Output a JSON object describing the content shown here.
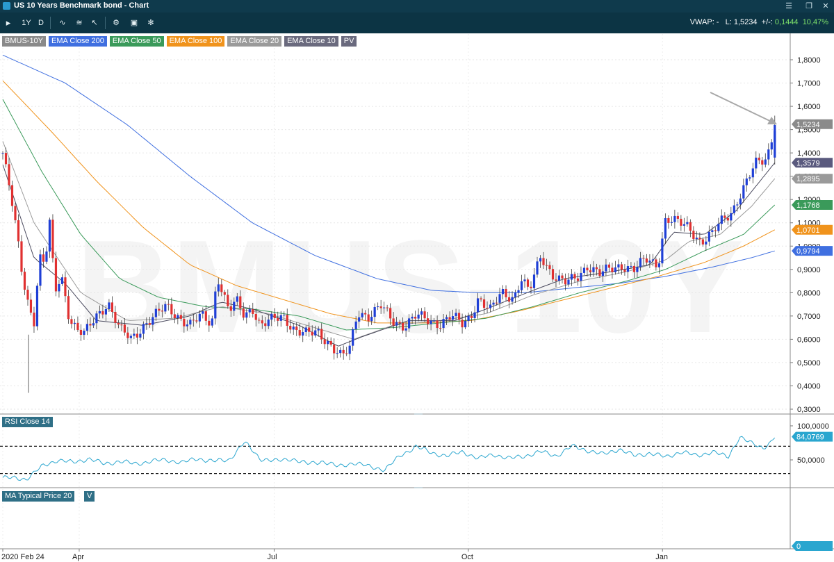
{
  "window": {
    "title": "US 10 Years Benchmark bond - Chart"
  },
  "toolbar": {
    "period": "1Y",
    "interval": "D",
    "vwap_label": "VWAP: -",
    "last_label": "L: 1,5234",
    "change_label": "+/-:",
    "change_value": "0,1444",
    "change_pct": "10,47%"
  },
  "legend": [
    {
      "label": "BMUS-10Y",
      "color": "#8a8a8a"
    },
    {
      "label": "EMA Close 200",
      "color": "#3f6fe0"
    },
    {
      "label": "EMA Close 50",
      "color": "#3a9a5a"
    },
    {
      "label": "EMA Close 100",
      "color": "#f0931c"
    },
    {
      "label": "EMA Close 20",
      "color": "#9a9a9a"
    },
    {
      "label": "EMA Close 10",
      "color": "#6a6a7e"
    },
    {
      "label": "PV",
      "color": "#6a6a7e"
    }
  ],
  "watermark": "BMUS-10Y",
  "rsi_label": "RSI Close 14",
  "ma_label": "MA Typical Price 20",
  "ma_flag": "V",
  "chart_data": {
    "type": "candlestick",
    "price_axis": {
      "min": 0.25,
      "max": 1.9,
      "ticks": [
        "1,8000",
        "1,7000",
        "1,6000",
        "1,5000",
        "1,4000",
        "1,3000",
        "1,2000",
        "1,1000",
        "1,0000",
        "0,9000",
        "0,8000",
        "0,7000",
        "0,6000",
        "0,5000",
        "0,4000",
        "0,3000"
      ]
    },
    "x_axis": {
      "labels": [
        {
          "label": "2020 Feb 24",
          "t": 0
        },
        {
          "label": "Apr",
          "t": 0.098
        },
        {
          "label": "Jul",
          "t": 0.348
        },
        {
          "label": "Oct",
          "t": 0.597
        },
        {
          "label": "Jan",
          "t": 0.846
        }
      ]
    },
    "price_keypoints": [
      [
        0.0,
        1.4
      ],
      [
        0.01,
        1.22
      ],
      [
        0.018,
        1.05
      ],
      [
        0.025,
        0.88
      ],
      [
        0.033,
        0.75
      ],
      [
        0.04,
        0.68
      ],
      [
        0.047,
        0.95
      ],
      [
        0.054,
        0.92
      ],
      [
        0.06,
        1.1
      ],
      [
        0.067,
        0.8
      ],
      [
        0.075,
        0.88
      ],
      [
        0.085,
        0.7
      ],
      [
        0.095,
        0.64
      ],
      [
        0.105,
        0.62
      ],
      [
        0.12,
        0.7
      ],
      [
        0.135,
        0.76
      ],
      [
        0.15,
        0.64
      ],
      [
        0.165,
        0.6
      ],
      [
        0.18,
        0.66
      ],
      [
        0.195,
        0.7
      ],
      [
        0.21,
        0.74
      ],
      [
        0.225,
        0.7
      ],
      [
        0.24,
        0.66
      ],
      [
        0.255,
        0.7
      ],
      [
        0.268,
        0.67
      ],
      [
        0.275,
        0.88
      ],
      [
        0.282,
        0.8
      ],
      [
        0.29,
        0.72
      ],
      [
        0.3,
        0.76
      ],
      [
        0.31,
        0.7
      ],
      [
        0.32,
        0.74
      ],
      [
        0.33,
        0.66
      ],
      [
        0.345,
        0.68
      ],
      [
        0.36,
        0.7
      ],
      [
        0.375,
        0.64
      ],
      [
        0.39,
        0.62
      ],
      [
        0.405,
        0.63
      ],
      [
        0.42,
        0.58
      ],
      [
        0.435,
        0.52
      ],
      [
        0.445,
        0.56
      ],
      [
        0.455,
        0.72
      ],
      [
        0.47,
        0.7
      ],
      [
        0.485,
        0.74
      ],
      [
        0.5,
        0.68
      ],
      [
        0.515,
        0.66
      ],
      [
        0.53,
        0.7
      ],
      [
        0.545,
        0.68
      ],
      [
        0.56,
        0.67
      ],
      [
        0.575,
        0.7
      ],
      [
        0.59,
        0.66
      ],
      [
        0.6,
        0.7
      ],
      [
        0.61,
        0.78
      ],
      [
        0.625,
        0.72
      ],
      [
        0.64,
        0.8
      ],
      [
        0.655,
        0.78
      ],
      [
        0.665,
        0.86
      ],
      [
        0.675,
        0.8
      ],
      [
        0.69,
        0.96
      ],
      [
        0.705,
        0.88
      ],
      [
        0.72,
        0.84
      ],
      [
        0.735,
        0.86
      ],
      [
        0.75,
        0.92
      ],
      [
        0.765,
        0.88
      ],
      [
        0.78,
        0.9
      ],
      [
        0.795,
        0.92
      ],
      [
        0.81,
        0.9
      ],
      [
        0.825,
        0.94
      ],
      [
        0.84,
        0.92
      ],
      [
        0.85,
        1.12
      ],
      [
        0.865,
        1.1
      ],
      [
        0.88,
        1.08
      ],
      [
        0.895,
        1.02
      ],
      [
        0.91,
        1.05
      ],
      [
        0.92,
        1.1
      ],
      [
        0.935,
        1.15
      ],
      [
        0.945,
        1.22
      ],
      [
        0.955,
        1.28
      ],
      [
        0.965,
        1.35
      ],
      [
        0.98,
        1.38
      ],
      [
        0.99,
        1.52
      ]
    ],
    "emas": [
      {
        "name": "EMA Close 10",
        "color": "#4a4a5e",
        "last": "1,3579",
        "points": [
          [
            0.0,
            1.35
          ],
          [
            0.04,
            0.95
          ],
          [
            0.08,
            0.84
          ],
          [
            0.12,
            0.68
          ],
          [
            0.18,
            0.66
          ],
          [
            0.24,
            0.7
          ],
          [
            0.28,
            0.76
          ],
          [
            0.32,
            0.73
          ],
          [
            0.38,
            0.66
          ],
          [
            0.43,
            0.57
          ],
          [
            0.46,
            0.61
          ],
          [
            0.52,
            0.68
          ],
          [
            0.58,
            0.68
          ],
          [
            0.62,
            0.73
          ],
          [
            0.68,
            0.81
          ],
          [
            0.72,
            0.86
          ],
          [
            0.78,
            0.89
          ],
          [
            0.83,
            0.92
          ],
          [
            0.86,
            1.06
          ],
          [
            0.9,
            1.05
          ],
          [
            0.94,
            1.15
          ],
          [
            0.99,
            1.3579
          ]
        ]
      },
      {
        "name": "EMA Close 20",
        "color": "#9a9a9a",
        "last": "1,2895",
        "points": [
          [
            0.0,
            1.45
          ],
          [
            0.04,
            1.1
          ],
          [
            0.1,
            0.8
          ],
          [
            0.16,
            0.68
          ],
          [
            0.22,
            0.69
          ],
          [
            0.28,
            0.74
          ],
          [
            0.34,
            0.71
          ],
          [
            0.4,
            0.65
          ],
          [
            0.45,
            0.6
          ],
          [
            0.5,
            0.66
          ],
          [
            0.56,
            0.68
          ],
          [
            0.62,
            0.71
          ],
          [
            0.68,
            0.79
          ],
          [
            0.74,
            0.85
          ],
          [
            0.8,
            0.89
          ],
          [
            0.85,
            0.94
          ],
          [
            0.88,
            1.02
          ],
          [
            0.92,
            1.05
          ],
          [
            0.96,
            1.17
          ],
          [
            0.99,
            1.2895
          ]
        ]
      },
      {
        "name": "EMA Close 50",
        "color": "#3a9a5a",
        "last": "1,1768",
        "points": [
          [
            0.0,
            1.63
          ],
          [
            0.05,
            1.32
          ],
          [
            0.1,
            1.05
          ],
          [
            0.15,
            0.86
          ],
          [
            0.2,
            0.78
          ],
          [
            0.26,
            0.74
          ],
          [
            0.32,
            0.73
          ],
          [
            0.38,
            0.7
          ],
          [
            0.44,
            0.64
          ],
          [
            0.5,
            0.65
          ],
          [
            0.56,
            0.67
          ],
          [
            0.62,
            0.69
          ],
          [
            0.68,
            0.74
          ],
          [
            0.74,
            0.8
          ],
          [
            0.8,
            0.85
          ],
          [
            0.85,
            0.9
          ],
          [
            0.9,
            0.98
          ],
          [
            0.95,
            1.05
          ],
          [
            0.99,
            1.1768
          ]
        ]
      },
      {
        "name": "EMA Close 100",
        "color": "#f0931c",
        "last": "1,0701",
        "points": [
          [
            0.0,
            1.71
          ],
          [
            0.06,
            1.5
          ],
          [
            0.12,
            1.28
          ],
          [
            0.18,
            1.08
          ],
          [
            0.24,
            0.92
          ],
          [
            0.3,
            0.83
          ],
          [
            0.36,
            0.77
          ],
          [
            0.42,
            0.71
          ],
          [
            0.48,
            0.67
          ],
          [
            0.54,
            0.67
          ],
          [
            0.6,
            0.68
          ],
          [
            0.66,
            0.72
          ],
          [
            0.72,
            0.77
          ],
          [
            0.78,
            0.82
          ],
          [
            0.84,
            0.87
          ],
          [
            0.9,
            0.93
          ],
          [
            0.95,
            1.0
          ],
          [
            0.99,
            1.0701
          ]
        ]
      },
      {
        "name": "EMA Close 200",
        "color": "#3f6fe0",
        "last": "0,9794",
        "points": [
          [
            0.0,
            1.82
          ],
          [
            0.08,
            1.7
          ],
          [
            0.16,
            1.52
          ],
          [
            0.24,
            1.3
          ],
          [
            0.32,
            1.1
          ],
          [
            0.4,
            0.96
          ],
          [
            0.48,
            0.86
          ],
          [
            0.55,
            0.81
          ],
          [
            0.61,
            0.8
          ],
          [
            0.67,
            0.8
          ],
          [
            0.73,
            0.82
          ],
          [
            0.79,
            0.84
          ],
          [
            0.85,
            0.87
          ],
          [
            0.91,
            0.91
          ],
          [
            0.96,
            0.95
          ],
          [
            0.99,
            0.9794
          ]
        ]
      }
    ],
    "last_price": "1,5234",
    "rsi": {
      "name": "RSI Close 14",
      "min": 0,
      "max": 100,
      "ticks": [
        "100,0000",
        "50,0000"
      ],
      "overbought": 70,
      "oversold": 30,
      "last": "84,0769",
      "points": [
        [
          0.0,
          24
        ],
        [
          0.03,
          22
        ],
        [
          0.05,
          40
        ],
        [
          0.07,
          50
        ],
        [
          0.09,
          46
        ],
        [
          0.11,
          52
        ],
        [
          0.13,
          44
        ],
        [
          0.15,
          48
        ],
        [
          0.17,
          44
        ],
        [
          0.19,
          48
        ],
        [
          0.21,
          50
        ],
        [
          0.23,
          46
        ],
        [
          0.25,
          52
        ],
        [
          0.27,
          48
        ],
        [
          0.29,
          50
        ],
        [
          0.31,
          76
        ],
        [
          0.33,
          52
        ],
        [
          0.35,
          48
        ],
        [
          0.37,
          52
        ],
        [
          0.39,
          44
        ],
        [
          0.41,
          48
        ],
        [
          0.43,
          40
        ],
        [
          0.45,
          46
        ],
        [
          0.47,
          40
        ],
        [
          0.49,
          36
        ],
        [
          0.51,
          56
        ],
        [
          0.53,
          70
        ],
        [
          0.55,
          60
        ],
        [
          0.57,
          56
        ],
        [
          0.59,
          62
        ],
        [
          0.61,
          52
        ],
        [
          0.63,
          58
        ],
        [
          0.65,
          52
        ],
        [
          0.67,
          56
        ],
        [
          0.69,
          62
        ],
        [
          0.71,
          56
        ],
        [
          0.73,
          70
        ],
        [
          0.75,
          64
        ],
        [
          0.77,
          58
        ],
        [
          0.79,
          66
        ],
        [
          0.81,
          56
        ],
        [
          0.83,
          60
        ],
        [
          0.85,
          54
        ],
        [
          0.87,
          62
        ],
        [
          0.89,
          56
        ],
        [
          0.91,
          62
        ],
        [
          0.93,
          54
        ],
        [
          0.945,
          84
        ],
        [
          0.96,
          74
        ],
        [
          0.975,
          68
        ],
        [
          0.985,
          76
        ],
        [
          0.99,
          84
        ]
      ]
    },
    "ma_typical_price": {
      "name": "MA Typical Price 20",
      "last": "0"
    }
  }
}
